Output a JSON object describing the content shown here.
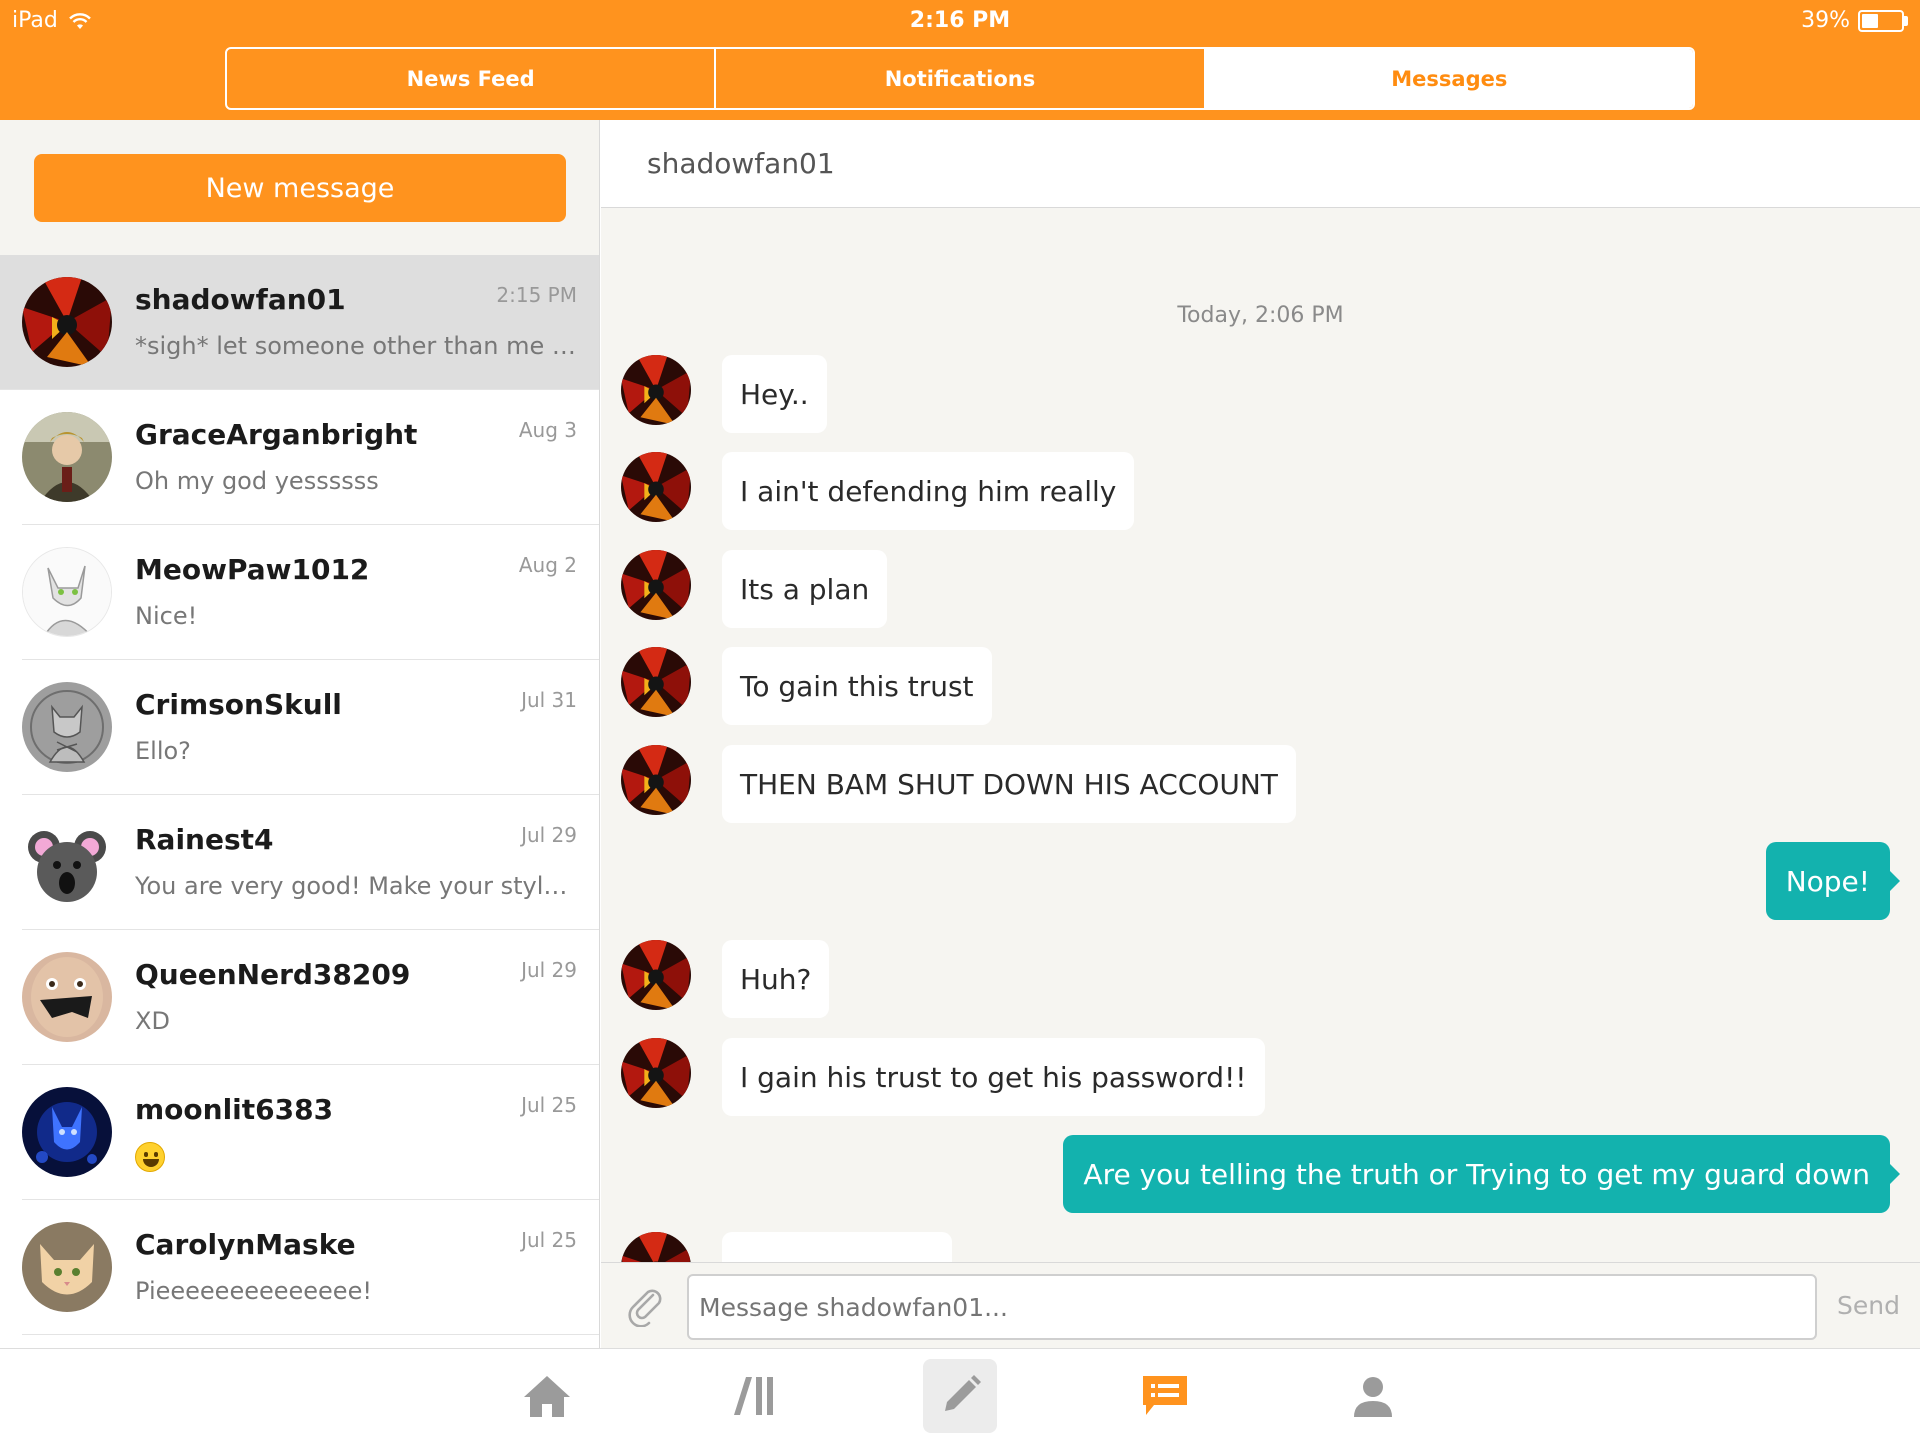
{
  "status_bar": {
    "carrier": "iPad",
    "time": "2:16 PM",
    "battery": "39%"
  },
  "tabs": [
    {
      "label": "News Feed",
      "active": false
    },
    {
      "label": "Notifications",
      "active": false
    },
    {
      "label": "Messages",
      "active": true
    }
  ],
  "sidebar": {
    "new_message_label": "New message",
    "conversations": [
      {
        "name": "shadowfan01",
        "preview": "*sigh* let someone other than me know when you start this",
        "date": "2:15 PM",
        "active": true
      },
      {
        "name": "GraceArganbright",
        "preview": "Oh my god yessssss",
        "date": "Aug 3"
      },
      {
        "name": "MeowPaw1012",
        "preview": "Nice!",
        "date": "Aug 2"
      },
      {
        "name": "CrimsonSkull",
        "preview": "Ello?",
        "date": "Jul 31"
      },
      {
        "name": "Rainest4",
        "preview": "You are very good! Make your style more",
        "date": "Jul 29"
      },
      {
        "name": "QueenNerd38209",
        "preview": "XD",
        "date": "Jul 29"
      },
      {
        "name": "moonlit6383",
        "preview": "",
        "date": "Jul 25",
        "preview_icon": "grinning-emoji"
      },
      {
        "name": "CarolynMaske",
        "preview": "Pieeeeeeeeeeeeee!",
        "date": "Jul 25"
      }
    ]
  },
  "chat": {
    "title": "shadowfan01",
    "timestamp": "Today, 2:06 PM",
    "messages": [
      {
        "from": "them",
        "text": "Hey.."
      },
      {
        "from": "them",
        "text": "I ain't defending him really"
      },
      {
        "from": "them",
        "text": "Its a plan"
      },
      {
        "from": "them",
        "text": "To gain this trust"
      },
      {
        "from": "them",
        "text": "THEN BAM SHUT DOWN HIS ACCOUNT"
      },
      {
        "from": "me",
        "text": "Nope!"
      },
      {
        "from": "them",
        "text": "Huh?"
      },
      {
        "from": "them",
        "text": "I gain his trust to get his password!!"
      },
      {
        "from": "me",
        "text": "Are you telling the truth or Trying to get my guard down"
      }
    ],
    "composer": {
      "placeholder": "Message shadowfan01...",
      "send_label": "Send"
    }
  },
  "bottom_nav": [
    {
      "icon": "home-icon"
    },
    {
      "icon": "library-icon"
    },
    {
      "icon": "pencil-icon",
      "active": true
    },
    {
      "icon": "messages-icon",
      "highlight": true
    },
    {
      "icon": "profile-icon"
    }
  ],
  "colors": {
    "brand_orange": "#ff931e",
    "teal_bubble": "#13b2ae",
    "chat_bg": "#f6f5f1"
  }
}
